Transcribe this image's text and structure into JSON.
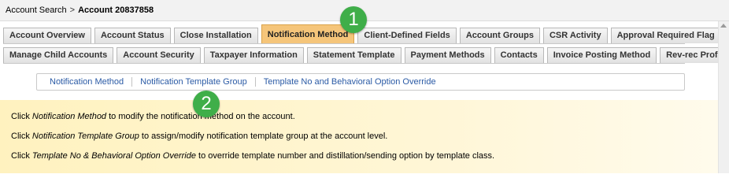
{
  "breadcrumb": {
    "root": "Account Search",
    "separator": ">",
    "current": "Account 20837858"
  },
  "tabs": {
    "row1": [
      {
        "label": "Account Overview"
      },
      {
        "label": "Account Status"
      },
      {
        "label": "Close Installation"
      },
      {
        "label": "Notification Method",
        "active": true
      },
      {
        "label": "Client-Defined Fields"
      },
      {
        "label": "Account Groups"
      },
      {
        "label": "CSR Activity"
      },
      {
        "label": "Approval Required Flag"
      }
    ],
    "row2": [
      {
        "label": "Manage Child Accounts"
      },
      {
        "label": "Account Security"
      },
      {
        "label": "Taxpayer Information"
      },
      {
        "label": "Statement Template"
      },
      {
        "label": "Payment Methods"
      },
      {
        "label": "Contacts"
      },
      {
        "label": "Invoice Posting Method"
      },
      {
        "label": "Rev-rec Profile"
      }
    ]
  },
  "subnav": {
    "items": [
      {
        "label": "Notification Method"
      },
      {
        "label": "Notification Template Group"
      },
      {
        "label": "Template No and Behavioral Option Override"
      }
    ]
  },
  "info": {
    "lines": [
      {
        "before": "Click ",
        "em": "Notification Method",
        "after": " to modify the notification method on the account."
      },
      {
        "before": "Click ",
        "em": "Notification Template Group",
        "after": " to assign/modify notification template group at the account level."
      },
      {
        "before": "Click ",
        "em": "Template No & Behavioral Option Override",
        "after": " to override template number and distillation/sending option by template class."
      }
    ]
  },
  "badges": {
    "one": "1",
    "two": "2"
  },
  "colors": {
    "active_tab": "#f5c57a",
    "badge": "#3fae49",
    "link": "#2a5aa5",
    "info_bg": "#fff2bf"
  }
}
